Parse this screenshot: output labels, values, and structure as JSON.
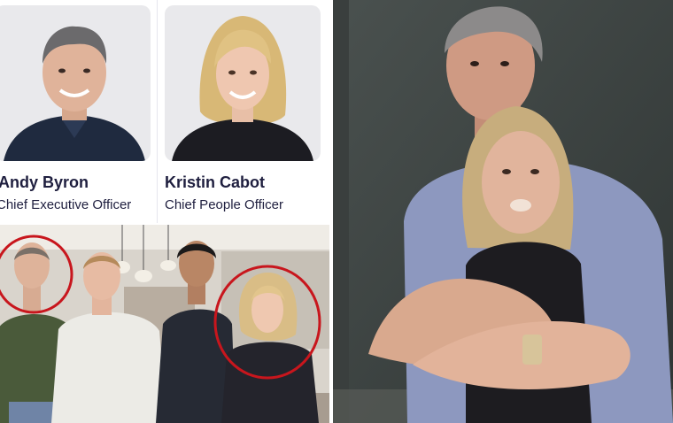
{
  "profiles": [
    {
      "name": "Andy Byron",
      "title": "Chief Executive Officer"
    },
    {
      "name": "Kristin Cabot",
      "title": "Chief People Officer"
    }
  ],
  "colors": {
    "name_text": "#1f1f3f",
    "highlight_circle": "#c8161d",
    "card_bg": "#ececf1"
  }
}
